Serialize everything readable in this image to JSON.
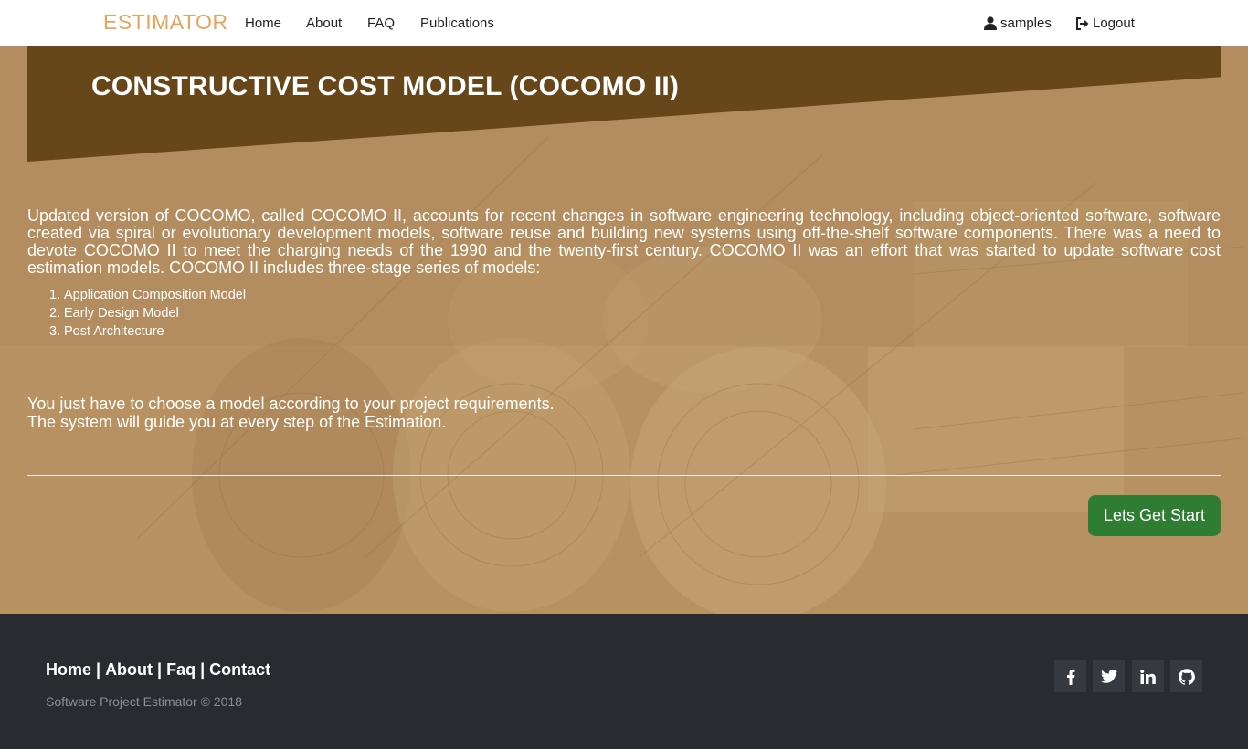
{
  "nav": {
    "brand": "ESTIMATOR",
    "links": [
      "Home",
      "About",
      "FAQ",
      "Publications"
    ],
    "user": "samples",
    "logout": "Logout"
  },
  "hero": {
    "title": "CONSTRUCTIVE COST MODEL (COCOMO II)",
    "intro": "Updated version of COCOMO, called COCOMO II, accounts for recent changes in software engineering technology, including object-oriented software, software created via spiral or evolutionary development models, software reuse and building new systems using off-the-shelf software components. There was a need to devote COCOMO II to meet the charging needs of the 1990 and the twenty-first century. COCOMO II was an effort that was started to update software cost estimation models. COCOMO II includes three-stage series of models:",
    "models": [
      {
        "num": "1.",
        "label": "Application Composition Model"
      },
      {
        "num": "2.",
        "label": "Early Design Model"
      },
      {
        "num": "3.",
        "label": "Post Architecture"
      }
    ],
    "guide_line1": "You just have to choose a model according to your project requirements.",
    "guide_line2": "The system will guide you at every step of the Estimation.",
    "cta": "Lets Get Start"
  },
  "footer": {
    "links": [
      "Home",
      "About",
      "Faq",
      "Contact"
    ],
    "separator": "|",
    "copyright": "Software Project Estimator © 2018",
    "social_icons": [
      "facebook-icon",
      "twitter-icon",
      "linkedin-icon",
      "github-icon"
    ]
  },
  "colors": {
    "brand": "#e9a35a",
    "banner": "#674719",
    "hero_bg": "#b89162",
    "cta": "#2e7d32",
    "footer": "#282c31"
  }
}
